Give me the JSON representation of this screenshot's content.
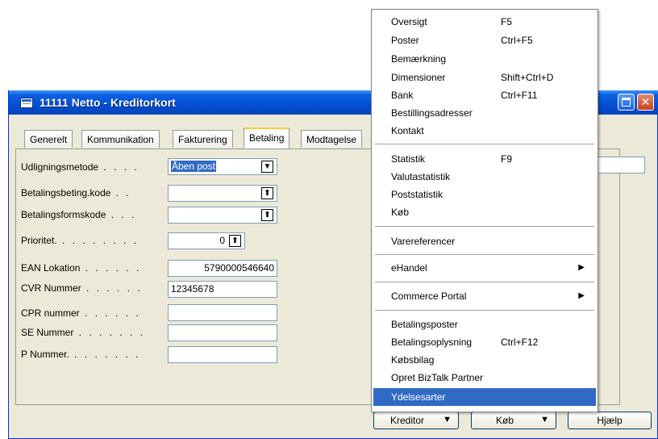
{
  "window": {
    "title": "11111 Netto - Kreditorkort"
  },
  "tabs": [
    "Generelt",
    "Kommunikation",
    "Fakturering",
    "Betaling",
    "Modtagelse"
  ],
  "fields": {
    "udligningsmetode": {
      "label": "Udligningsmetode",
      "value_selected": "Åben post"
    },
    "betalingsbeting": {
      "label": "Betalingsbeting.kode",
      "value": ""
    },
    "betalingsform": {
      "label": "Betalingsformskode",
      "value": ""
    },
    "prioritet": {
      "label": "Prioritet.",
      "value": "0"
    },
    "ean": {
      "label": "EAN Lokation",
      "value": "5790000546640"
    },
    "cvr": {
      "label": "CVR Nummer",
      "value": "12345678"
    },
    "cpr": {
      "label": "CPR nummer",
      "value": ""
    },
    "se": {
      "label": "SE Nummer",
      "value": ""
    },
    "pnummer": {
      "label": "P Nummer.",
      "value": ""
    }
  },
  "menu": {
    "items": [
      {
        "label": "Oversigt",
        "shortcut": "F5"
      },
      {
        "label": "Poster",
        "shortcut": "Ctrl+F5"
      },
      {
        "label": "Bemærkning",
        "shortcut": ""
      },
      {
        "label": "Dimensioner",
        "shortcut": "Shift+Ctrl+D"
      },
      {
        "label": "Bank",
        "shortcut": "Ctrl+F11"
      },
      {
        "label": "Bestillingsadresser",
        "shortcut": ""
      },
      {
        "label": "Kontakt",
        "shortcut": ""
      },
      {
        "label": "Statistik",
        "shortcut": "F9"
      },
      {
        "label": "Valutastatistik",
        "shortcut": ""
      },
      {
        "label": "Poststatistik",
        "shortcut": ""
      },
      {
        "label": "Køb",
        "shortcut": ""
      },
      {
        "label": "Varereferencer",
        "shortcut": ""
      },
      {
        "label": "eHandel",
        "shortcut": ""
      },
      {
        "label": "Commerce Portal",
        "shortcut": ""
      },
      {
        "label": "Betalingsposter",
        "shortcut": ""
      },
      {
        "label": "Betalingsoplysning",
        "shortcut": "Ctrl+F12"
      },
      {
        "label": "Købsbilag",
        "shortcut": ""
      },
      {
        "label": "Opret BizTalk Partner",
        "shortcut": ""
      },
      {
        "label": "Ydelsesarter",
        "shortcut": ""
      }
    ]
  },
  "buttons": {
    "kreditor": "Kreditor",
    "kob": "Køb",
    "hjaelp": "Hjælp"
  },
  "icons": {
    "menu_submenu": "submenu-arrow-icon",
    "dropdown": "dropdown-arrow-icon",
    "lookup": "lookup-arrow-icon"
  }
}
